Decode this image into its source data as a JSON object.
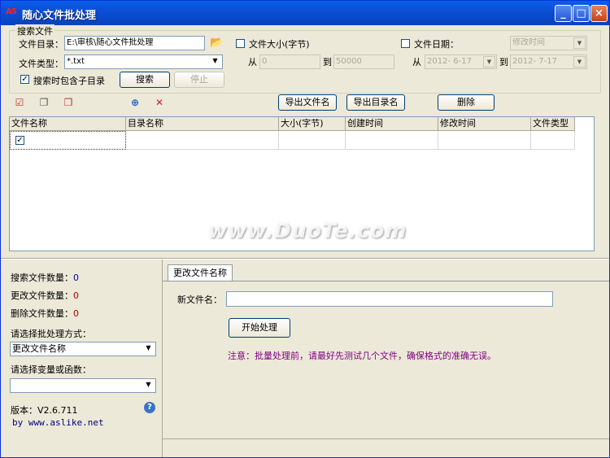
{
  "window": {
    "title": "随心文件批处理",
    "icon_text": "AS"
  },
  "search_group": {
    "title": "搜索文件",
    "dir_label": "文件目录：",
    "dir_value": "E:\\审核\\随心文件批处理",
    "type_label": "文件类型：",
    "type_value": "*.txt",
    "include_sub_label": "搜索时包含子目录",
    "include_sub_checked": true,
    "search_button": "搜索",
    "stop_button": "停止",
    "size_label": "文件大小(字节)",
    "size_from_label": "从",
    "size_from": "0",
    "size_to_label": "到",
    "size_to": "50000",
    "date_label": "文件日期：",
    "date_kind": "修改时间",
    "date_from_label": "从",
    "date_from": "2012- 6-17",
    "date_to_label": "到",
    "date_to": "2012- 7-17"
  },
  "toolbar": {
    "export_names": "导出文件名",
    "export_dirs": "导出目录名",
    "delete": "删除"
  },
  "grid": {
    "columns": [
      "文件名称",
      "目录名称",
      "大小(字节)",
      "创建时间",
      "修改时间",
      "文件类型"
    ]
  },
  "watermark": "www.DuoTe.com",
  "stats": {
    "search_count_label": "搜索文件数量：",
    "search_count": "0",
    "rename_count_label": "更改文件数量：",
    "rename_count": "0",
    "delete_count_label": "删除文件数量：",
    "delete_count": "0"
  },
  "method": {
    "label": "请选择批处理方式：",
    "value": "更改文件名称"
  },
  "variable": {
    "label": "请选择变量或函数：",
    "value": ""
  },
  "version": {
    "label": "版本：V2.6.711",
    "site": "by www.aslike.net"
  },
  "tab": {
    "label": "更改文件名称",
    "new_name_label": "新文件名：",
    "new_name_value": "",
    "start_button": "开始处理",
    "note": "注意：批量处理前，请最好先测试几个文件，确保格式的准确无误。"
  },
  "colors": {
    "title_bar": "#0a4fd6",
    "note": "#800080",
    "count_zero_blue": "#0000c0",
    "count_zero_red": "#c00000"
  }
}
